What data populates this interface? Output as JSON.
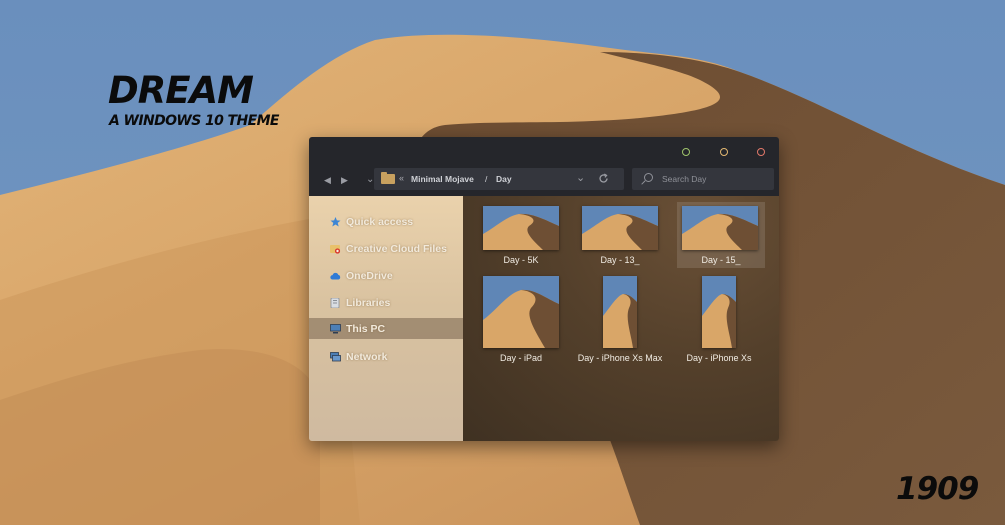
{
  "branding": {
    "title": "DREAM",
    "subtitle": "A WINDOWS 10 THEME",
    "version": "1909"
  },
  "colors": {
    "sky": "#6b92bf",
    "dune_light": "#d8a368",
    "dune_shadow": "#6e4f34",
    "window_chrome": "#25262b",
    "field_bg": "#34363d",
    "sidebar_bg": "#e3cba5",
    "content_bg": "#4f3c29",
    "window_btn_green": "#9fc46b",
    "window_btn_yellow": "#e3b871",
    "window_btn_red": "#e2786a"
  },
  "window": {
    "buttons": [
      {
        "name": "minimize",
        "color": "#9fc46b"
      },
      {
        "name": "maximize",
        "color": "#e3b871"
      },
      {
        "name": "close",
        "color": "#e2786a"
      }
    ],
    "nav": {
      "back_icon": "caret-left-icon",
      "forward_icon": "caret-right-icon",
      "recent_icon": "chevron-down-icon",
      "breadcrumb_icon": "double-chevron-left-icon",
      "breadcrumb": [
        "Minimal Mojave",
        "Day"
      ],
      "breadcrumb_separator": "/",
      "dropdown_icon": "chevron-down-icon",
      "refresh_icon": "refresh-icon"
    },
    "search": {
      "placeholder": "Search Day",
      "value": ""
    }
  },
  "sidebar": {
    "items": [
      {
        "label": "Quick access",
        "icon": "star-icon",
        "selected": false
      },
      {
        "label": "Creative Cloud Files",
        "icon": "creative-cloud-folder-icon",
        "selected": false
      },
      {
        "label": "OneDrive",
        "icon": "cloud-icon",
        "selected": false
      },
      {
        "label": "Libraries",
        "icon": "library-icon",
        "selected": false
      },
      {
        "label": "This PC",
        "icon": "computer-icon",
        "selected": true
      },
      {
        "label": "Network",
        "icon": "network-icon",
        "selected": false
      }
    ]
  },
  "files": [
    {
      "label": "Day - 5K",
      "orientation": "landscape",
      "selected": false
    },
    {
      "label": "Day - 13_",
      "orientation": "landscape",
      "selected": false
    },
    {
      "label": "Day - 15_",
      "orientation": "landscape",
      "selected": true
    },
    {
      "label": "Day - iPad",
      "orientation": "tablet",
      "selected": false
    },
    {
      "label": "Day - iPhone Xs Max",
      "orientation": "portrait",
      "selected": false
    },
    {
      "label": "Day - iPhone Xs",
      "orientation": "portrait",
      "selected": false
    }
  ]
}
